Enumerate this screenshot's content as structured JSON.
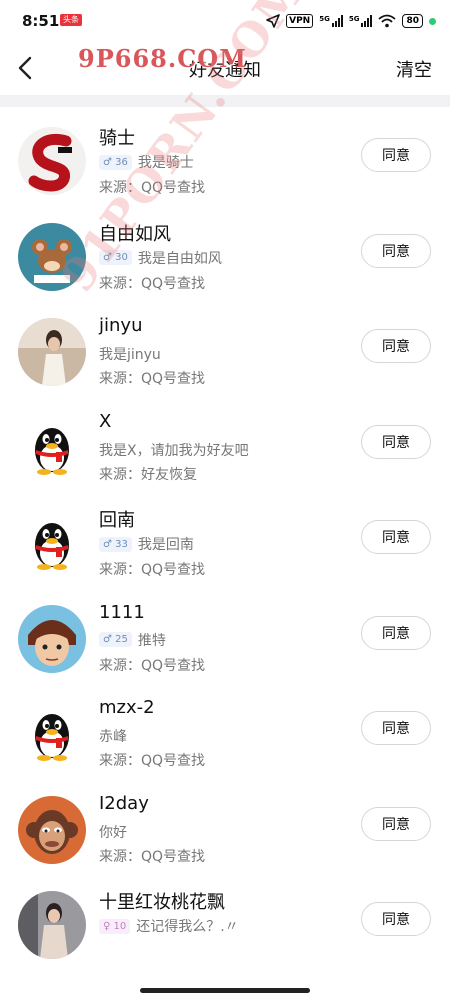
{
  "status": {
    "time": "8:51",
    "badge": "头条",
    "vpn": "VPN",
    "sig1": "5G",
    "sig2": "5G",
    "battery": "80"
  },
  "nav": {
    "title": "好友通知",
    "clear_label": "清空"
  },
  "watermark": {
    "top": "9P668.COM",
    "diagonal": "91PORN.COM"
  },
  "agree_label": "同意",
  "requests": [
    {
      "name": "骑士",
      "age": "♂ 36",
      "message": "我是骑士",
      "source": "来源：QQ号查找"
    },
    {
      "name": "自由如风",
      "age": "♂ 30",
      "message": "我是自由如风",
      "source": "来源：QQ号查找"
    },
    {
      "name": "jinyu",
      "message": "我是jinyu",
      "source": "来源：QQ号查找"
    },
    {
      "name": "X",
      "message": "我是X，请加我为好友吧",
      "source": "来源：好友恢复"
    },
    {
      "name": "回南",
      "age": "♂ 33",
      "message": "我是回南",
      "source": "来源：QQ号查找"
    },
    {
      "name": "1111",
      "age": "♂ 25",
      "message": "推特",
      "source": "来源：QQ号查找"
    },
    {
      "name": "mzx-2",
      "message": "赤峰",
      "source": "来源：QQ号查找"
    },
    {
      "name": "I2day",
      "message": "你好",
      "source": "来源：QQ号查找"
    },
    {
      "name": "十里红妆桃花飘",
      "age": "♀ 10",
      "message": "还记得我么？.〃",
      "source": ""
    }
  ]
}
